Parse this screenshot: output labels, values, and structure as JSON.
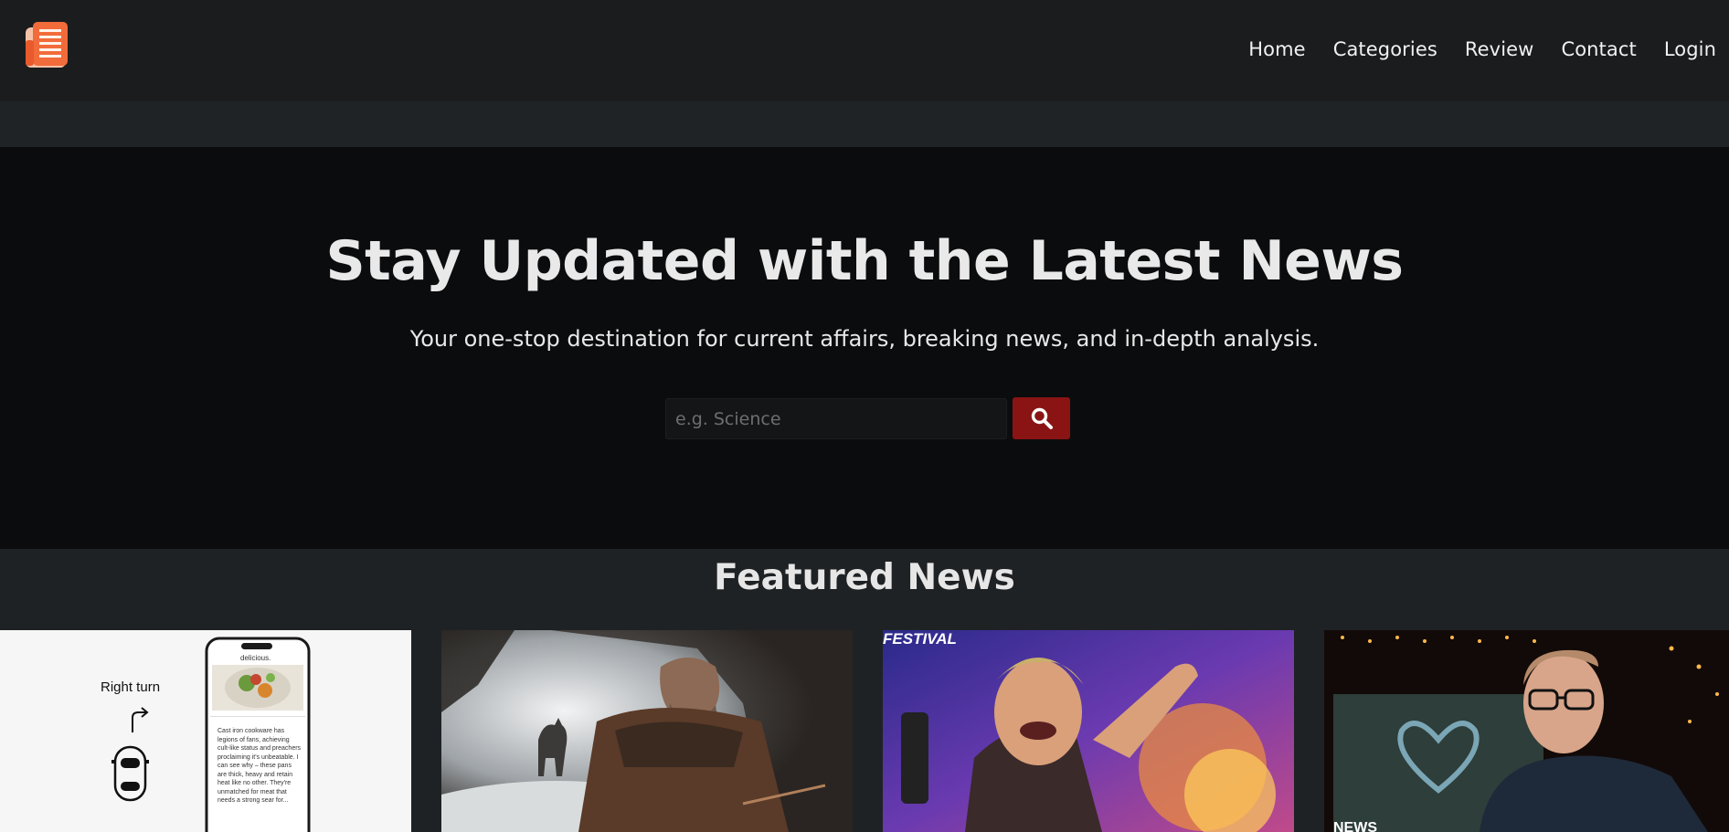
{
  "header": {
    "logo": "newspaper-logo",
    "nav": [
      {
        "label": "Home"
      },
      {
        "label": "Categories"
      },
      {
        "label": "Review"
      },
      {
        "label": "Contact"
      },
      {
        "label": "Login"
      }
    ]
  },
  "hero": {
    "title": "Stay Updated with the Latest News",
    "subtitle": "Your one-stop destination for current affairs, breaking news, and in-depth analysis.",
    "search": {
      "placeholder": "e.g. Science",
      "button_icon": "search-icon"
    }
  },
  "featured": {
    "title": "Featured News",
    "cards": [
      {
        "image_text": {
          "turn_label": "Right turn",
          "phone_app": "delicious.",
          "phone_body": "Cast iron cookware has legions of fans, achieving cult-like status and preachers proclaiming it's unbeatable. I can see why – these pans are thick, heavy and retain heat like no other. They're unmatched for meat that needs a strong sear for..."
        }
      },
      {
        "image_text": {}
      },
      {
        "image_text": {
          "banner": "FESTIVAL"
        }
      },
      {
        "image_text": {
          "logo_text": "NEWS"
        }
      }
    ]
  },
  "colors": {
    "topbar": "#1b1c1e",
    "hero_bg": "#0b0c0d",
    "accent": "#8a1414",
    "logo": "#f26b3a"
  }
}
